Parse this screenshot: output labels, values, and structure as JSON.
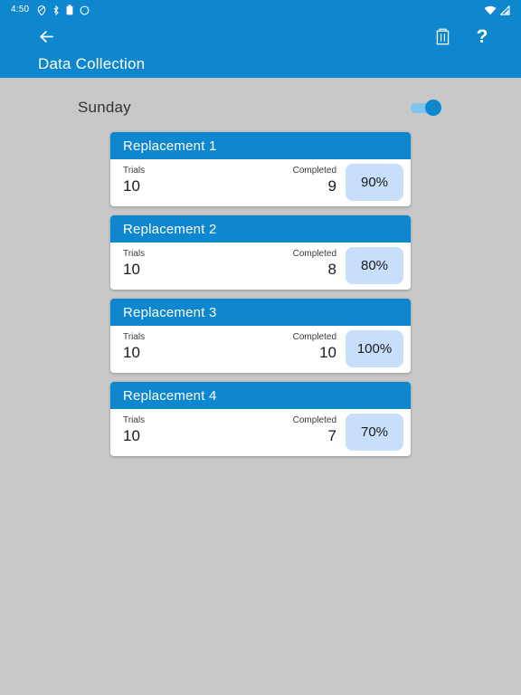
{
  "status_bar": {
    "clock": "4:50",
    "left_icons": [
      "location-icon",
      "bluetooth-icon",
      "battery-icon",
      "sync-icon"
    ],
    "right_icons": [
      "wifi-icon",
      "cell-signal-icon"
    ]
  },
  "app_bar": {
    "back_icon": "back-arrow-icon",
    "delete_icon": "delete-icon",
    "help_label": "?",
    "title": "Data Collection"
  },
  "day_row": {
    "label": "Sunday",
    "toggle_state": "on"
  },
  "colors": {
    "primary_blue": "#0e87cf",
    "page_background": "#c8c8c8",
    "badge_blue": "#c7dffb",
    "card_white": "#ffffff"
  },
  "labels": {
    "trials": "Trials",
    "completed": "Completed"
  },
  "cards": [
    {
      "title": "Replacement 1",
      "trials_label": "Trials",
      "trials": "10",
      "completed_label": "Completed",
      "completed": "9",
      "percent": "90%"
    },
    {
      "title": "Replacement 2",
      "trials_label": "Trials",
      "trials": "10",
      "completed_label": "Completed",
      "completed": "8",
      "percent": "80%"
    },
    {
      "title": "Replacement 3",
      "trials_label": "Trials",
      "trials": "10",
      "completed_label": "Completed",
      "completed": "10",
      "percent": "100%"
    },
    {
      "title": "Replacement 4",
      "trials_label": "Trials",
      "trials": "10",
      "completed_label": "Completed",
      "completed": "7",
      "percent": "70%"
    }
  ]
}
